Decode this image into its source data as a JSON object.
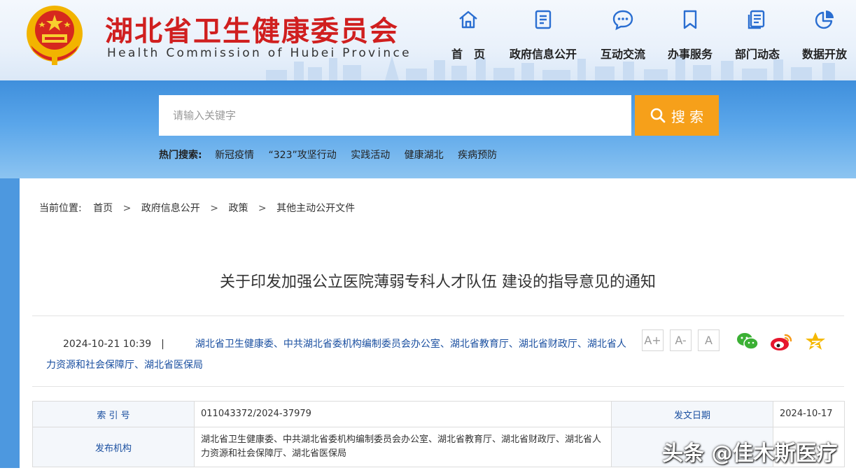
{
  "header": {
    "title_cn": "湖北省卫生健康委员会",
    "title_en": "Health Commission of Hubei Province"
  },
  "nav": [
    {
      "label": "首　页",
      "icon": "home-icon"
    },
    {
      "label": "政府信息公开",
      "icon": "document-icon"
    },
    {
      "label": "互动交流",
      "icon": "chat-icon"
    },
    {
      "label": "办事服务",
      "icon": "bookmark-icon"
    },
    {
      "label": "部门动态",
      "icon": "news-icon"
    },
    {
      "label": "数据开放",
      "icon": "pie-chart-icon"
    }
  ],
  "search": {
    "placeholder": "请输入关键字",
    "button_label": "搜 索",
    "hot_label": "热门搜索:",
    "hot_items": [
      "新冠疫情",
      "“323”攻坚行动",
      "实践活动",
      "健康湖北",
      "疾病预防"
    ]
  },
  "breadcrumb": {
    "label": "当前位置:",
    "items": [
      "首页",
      "政府信息公开",
      "政策",
      "其他主动公开文件"
    ],
    "separator": ">"
  },
  "article": {
    "title": "关于印发加强公立医院薄弱专科人才队伍 建设的指导意见的通知",
    "datetime": "2024-10-21 10:39",
    "pipe": "|",
    "publisher": "湖北省卫生健康委、中共湖北省委机构编制委员会办公室、湖北省教育厅、湖北省财政厅、湖北省人力资源和社会保障厅、湖北省医保局"
  },
  "font_controls": [
    "A+",
    "A-",
    "A"
  ],
  "share": [
    "wechat-icon",
    "weibo-icon",
    "favorite-icon"
  ],
  "info_table": {
    "index_label": "索 引 号",
    "index_value": "011043372/2024-37979",
    "date_label": "发文日期",
    "date_value": "2024-10-17",
    "publisher_label": "发布机构",
    "publisher_value": "湖北省卫生健康委、中共湖北省委机构编制委员会办公室、湖北省教育厅、湖北省财政厅、湖北省人力资源和社会保障厅、湖北省医保局"
  },
  "watermark": "头条 @佳木斯医疗",
  "colors": {
    "brand_red": "#d01f1f",
    "accent_orange": "#f6a01a",
    "nav_blue": "#2a6ed1",
    "link_blue": "#1a4fa0"
  }
}
